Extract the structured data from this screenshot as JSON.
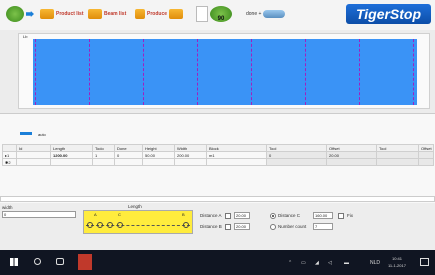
{
  "toolbar": {
    "product_list": "Product list",
    "beam_list": "Beam list",
    "produce": "Produce",
    "badge_count": "90",
    "done_label": "done +",
    "logo": "TigerStop"
  },
  "viewport": {
    "left_label": "Lb",
    "right_label": ""
  },
  "grid": {
    "left_header": "auto",
    "columns": [
      "Id",
      "Length",
      "Todo",
      "Done",
      "Height",
      "Width",
      "Block",
      "Tool",
      "Offset",
      "Tool",
      "Offset"
    ],
    "rows": [
      {
        "marker": "▸1",
        "id": "",
        "length": "1200.00",
        "todo": "1",
        "done": "0",
        "height": "50.00",
        "width": "200.00",
        "block": "m1",
        "tool1": "0",
        "offset1": "20.00",
        "tool2": "",
        "offset2": ""
      },
      {
        "marker": "✱2",
        "id": "",
        "length": "",
        "todo": "",
        "done": "",
        "height": "",
        "width": "",
        "block": "",
        "tool1": "",
        "offset1": "",
        "tool2": "",
        "offset2": ""
      }
    ]
  },
  "bottom": {
    "width_label": "width",
    "width_value": "0",
    "length_label": "Length",
    "distance_a_label": "Distance A",
    "distance_a_value": "20.00",
    "distance_b_label": "Distance B",
    "distance_b_value": "20.00",
    "distance_c_label": "Distance C",
    "distance_c_value": "160.00",
    "number_count_label": "Number count",
    "number_count_value": "7",
    "fix_label": "Fix",
    "diagram_a": "A",
    "diagram_b": "B",
    "diagram_c": "C"
  },
  "taskbar": {
    "lang": "NLD",
    "time": "10:41",
    "date": "11-1-2017"
  }
}
